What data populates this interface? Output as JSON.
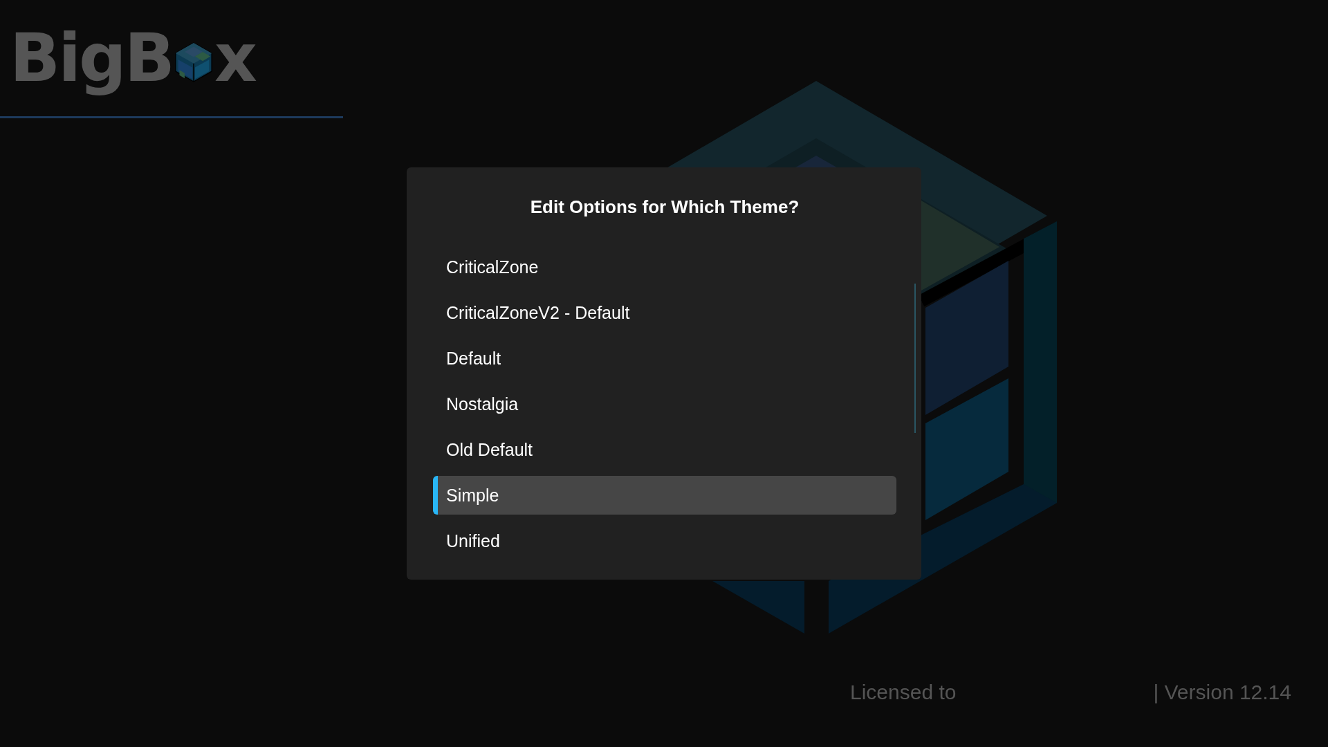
{
  "logo": {
    "text_before": "BigB",
    "text_after": "x"
  },
  "dialog": {
    "title": "Edit Options for Which Theme?",
    "items": [
      {
        "label": "CriticalZone",
        "selected": false
      },
      {
        "label": "CriticalZoneV2 - Default",
        "selected": false
      },
      {
        "label": "Default",
        "selected": false
      },
      {
        "label": "Nostalgia",
        "selected": false
      },
      {
        "label": "Old Default",
        "selected": false
      },
      {
        "label": "Simple",
        "selected": true
      },
      {
        "label": "Unified",
        "selected": false
      }
    ]
  },
  "footer": {
    "license": "Licensed to",
    "version": "| Version 12.14"
  }
}
